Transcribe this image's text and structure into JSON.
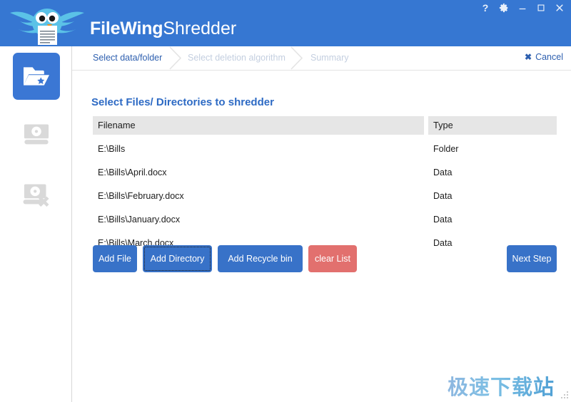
{
  "window": {
    "brand_bold": "FileWing",
    "brand_light": "Shredder",
    "controls": [
      {
        "name": "help-button",
        "glyph": "?"
      },
      {
        "name": "settings-button",
        "glyph": "gear-icon"
      },
      {
        "name": "minimize-button",
        "glyph": "minimize-icon"
      },
      {
        "name": "maximize-button",
        "glyph": "maximize-icon"
      },
      {
        "name": "close-button",
        "glyph": "close-icon"
      }
    ]
  },
  "sidebar": {
    "items": [
      {
        "icon": "folder-star-icon",
        "active": true
      },
      {
        "icon": "disk-icon",
        "active": false
      },
      {
        "icon": "disk-delete-icon",
        "active": false
      }
    ]
  },
  "breadcrumb": {
    "steps": [
      {
        "label": "Select data/folder",
        "active": true
      },
      {
        "label": "Select deletion algorithm",
        "active": false
      },
      {
        "label": "Summary",
        "active": false
      }
    ],
    "cancel_label": "Cancel",
    "cancel_icon": "close-icon"
  },
  "main": {
    "title": "Select Files/ Directories to shredder",
    "table": {
      "columns": [
        "Filename",
        "Type"
      ],
      "rows": [
        {
          "filename": "E:\\Bills",
          "type": "Folder"
        },
        {
          "filename": "E:\\Bills\\April.docx",
          "type": "Data"
        },
        {
          "filename": "E:\\Bills\\February.docx",
          "type": "Data"
        },
        {
          "filename": "E:\\Bills\\January.docx",
          "type": "Data"
        },
        {
          "filename": "E:\\Bills\\March.docx",
          "type": "Data"
        }
      ]
    },
    "buttons": {
      "add_file": "Add File",
      "add_directory": "Add Directory",
      "add_recycle_bin": "Add Recycle bin",
      "clear_list": "clear List",
      "next_step": "Next Step"
    }
  },
  "watermark": "极速下载站",
  "colors": {
    "header_blue": "#3677d2",
    "accent_blue": "#3872c8",
    "title_blue": "#2d6ac4",
    "danger_red": "#e2706e",
    "table_header_gray": "#e6e6e6",
    "muted_crumb": "#c4cfe0"
  }
}
